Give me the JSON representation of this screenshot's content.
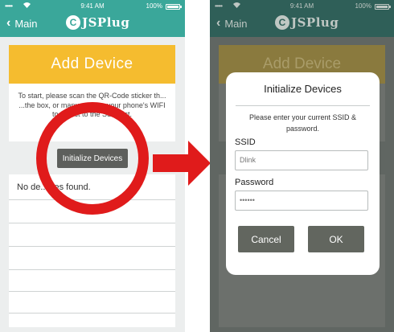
{
  "status_bar": {
    "carrier": "•••••",
    "time": "9:41 AM",
    "battery": "100%"
  },
  "nav": {
    "back_label": "Main",
    "logo_mark": "C",
    "logo_text": "JSPlug"
  },
  "left_screen": {
    "card_title": "Add Device",
    "instructions": "To start, please scan the QR-Code sticker th... ...the box, or manu... ...use your phone's WIFI to ...nect to the SSID list.",
    "init_button": "Initialize Devices",
    "empty_list_text": "No de...ices found."
  },
  "right_screen": {
    "bg_card_title": "Add Device",
    "dialog": {
      "title": "Initialize Devices",
      "message": "Please enter your current SSID & password.",
      "ssid_label": "SSID",
      "ssid_value": "Dlink",
      "password_label": "Password",
      "password_value": "••••••",
      "cancel_label": "Cancel",
      "ok_label": "OK"
    }
  },
  "colors": {
    "teal": "#3aa79a",
    "yellow": "#f5bc2f",
    "red": "#e01b1b",
    "button_gray": "#5d5f5c"
  }
}
